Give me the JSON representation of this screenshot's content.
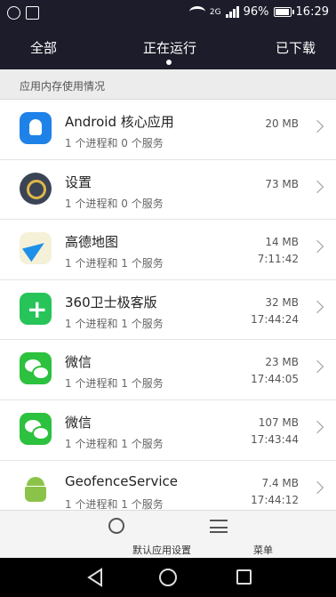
{
  "status_bar": {
    "battery": "96%",
    "time": "16:29",
    "network": "2G"
  },
  "tabs": {
    "all": "全部",
    "running": "正在运行",
    "downloaded": "已下载"
  },
  "section_title": "应用内存使用情况",
  "apps": [
    {
      "name": "Android 核心应用",
      "sub": "1 个进程和 0 个服务",
      "size": "20 MB",
      "time": "",
      "icon": "android-core-icon"
    },
    {
      "name": "设置",
      "sub": "1 个进程和 0 个服务",
      "size": "73 MB",
      "time": "",
      "icon": "settings-gear-icon"
    },
    {
      "name": "高德地图",
      "sub": "1 个进程和 1 个服务",
      "size": "14 MB",
      "time": "7:11:42",
      "icon": "amap-icon"
    },
    {
      "name": "360卫士极客版",
      "sub": "1 个进程和 1 个服务",
      "size": "32 MB",
      "time": "17:44:24",
      "icon": "security-360-icon"
    },
    {
      "name": "微信",
      "sub": "1 个进程和 1 个服务",
      "size": "23 MB",
      "time": "17:44:05",
      "icon": "wechat-icon"
    },
    {
      "name": "微信",
      "sub": "1 个进程和 1 个服务",
      "size": "107 MB",
      "time": "17:43:44",
      "icon": "wechat-icon"
    },
    {
      "name": "GeofenceService",
      "sub": "1 个进程和 1 个服务",
      "size": "7.4 MB",
      "time": "17:44:12",
      "icon": "android-robot-icon"
    }
  ],
  "bottom_bar": {
    "default_apps": "默认应用设置",
    "menu": "菜单"
  }
}
